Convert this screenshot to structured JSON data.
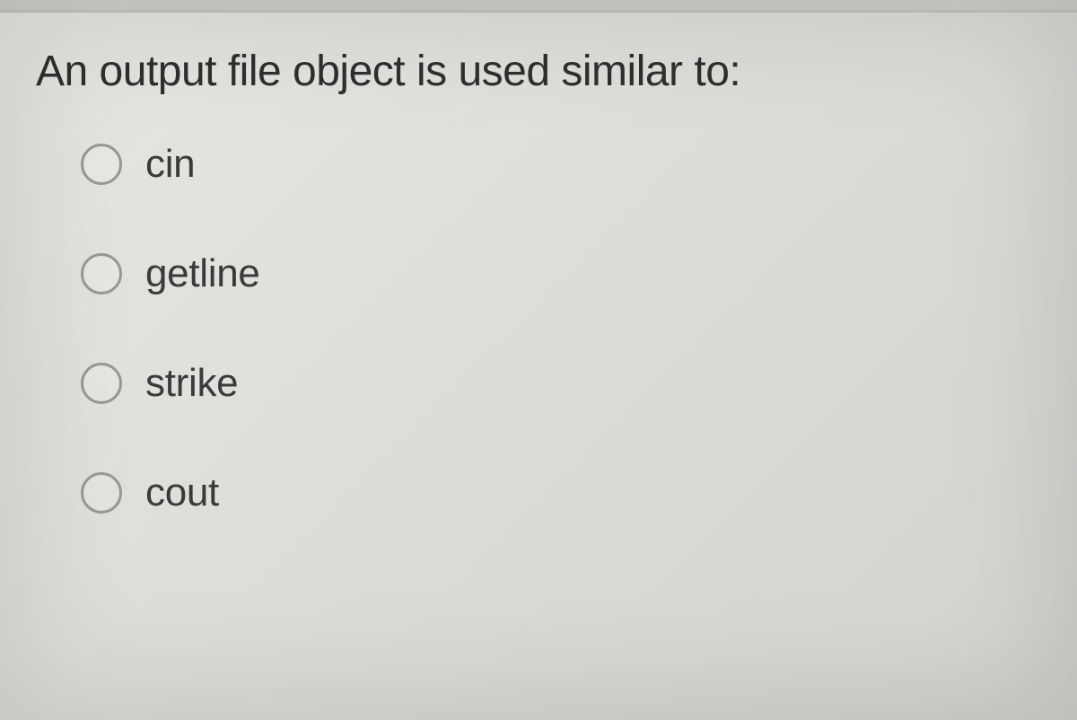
{
  "question": {
    "prompt": "An output file object is used similar to:",
    "options": [
      {
        "label": "cin"
      },
      {
        "label": "getline"
      },
      {
        "label": "strike"
      },
      {
        "label": "cout"
      }
    ]
  }
}
